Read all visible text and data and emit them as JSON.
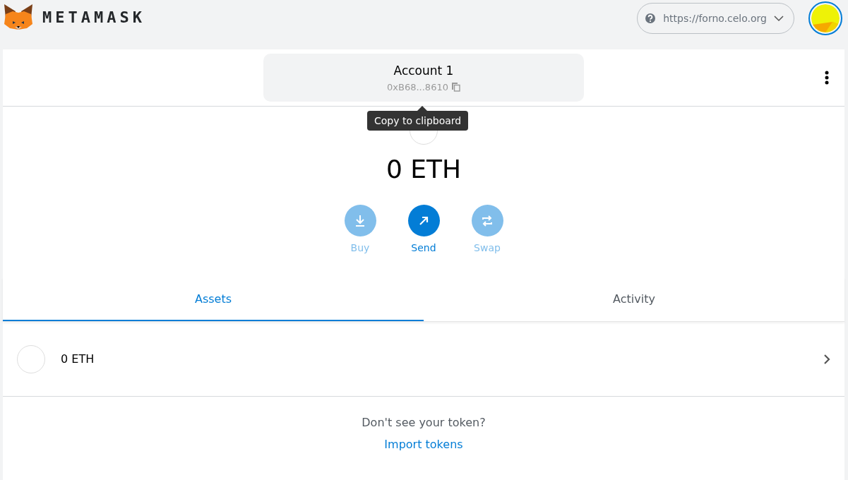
{
  "header": {
    "brand": "METAMASK",
    "network": "https://forno.celo.org"
  },
  "account": {
    "name": "Account 1",
    "address": "0xB68...8610",
    "tooltip": "Copy to clipboard"
  },
  "balance": "0 ETH",
  "actions": [
    {
      "label": "Buy",
      "kind": "buy",
      "disabled": true
    },
    {
      "label": "Send",
      "kind": "send",
      "disabled": false
    },
    {
      "label": "Swap",
      "kind": "swap",
      "disabled": true
    }
  ],
  "tabs": [
    {
      "label": "Assets",
      "selected": true
    },
    {
      "label": "Activity",
      "selected": false
    }
  ],
  "assets": [
    {
      "amount": "0 ETH"
    }
  ],
  "footer": {
    "prompt": "Don't see your token?",
    "link": "Import tokens"
  }
}
